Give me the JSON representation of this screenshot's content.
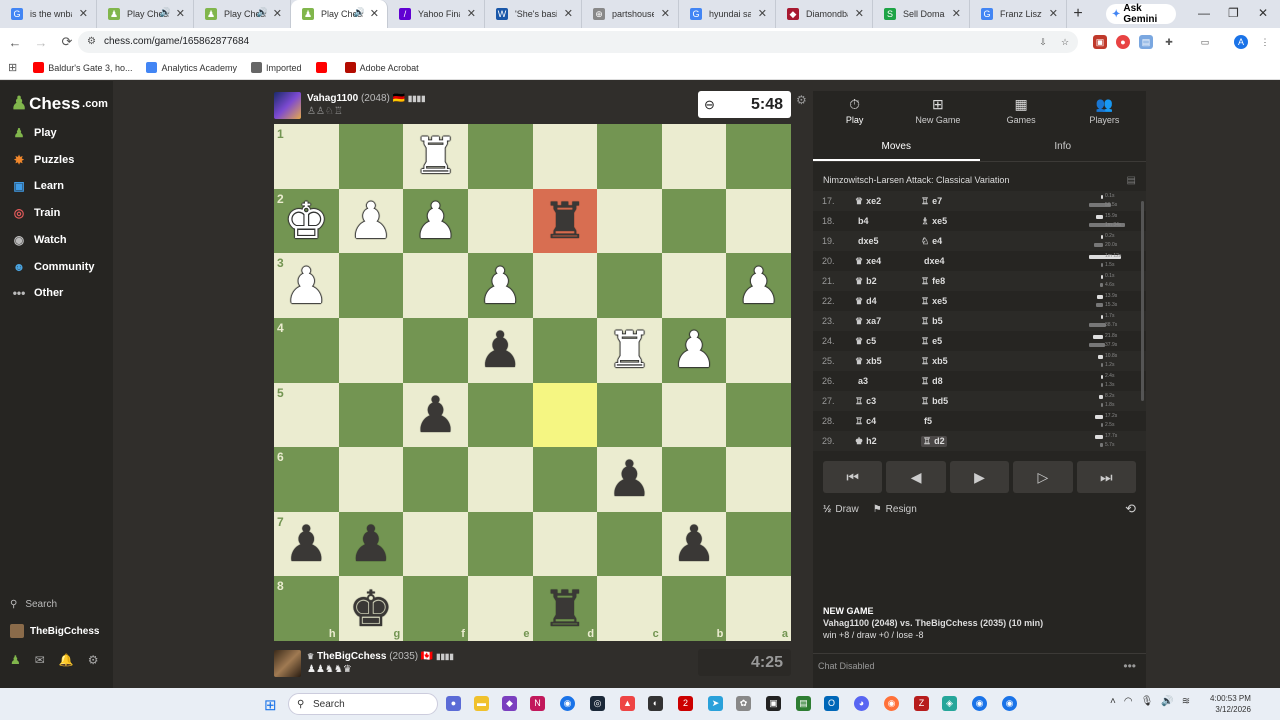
{
  "browser": {
    "tabs": [
      {
        "title": "is the wnba p",
        "color": "#4285f4",
        "glyph": "G",
        "active": false
      },
      {
        "title": "Play Chess",
        "color": "#81b64c",
        "glyph": "♟",
        "active": false,
        "sound": true
      },
      {
        "title": "Play Chess",
        "color": "#81b64c",
        "glyph": "♟",
        "active": false,
        "sound": true
      },
      {
        "title": "Play Chess",
        "color": "#81b64c",
        "glyph": "♟",
        "active": true,
        "sound": true
      },
      {
        "title": "Yahoo Finance",
        "color": "#6001d2",
        "glyph": "/",
        "active": false
      },
      {
        "title": "'She's basical",
        "color": "#1a57a8",
        "glyph": "W",
        "active": false
      },
      {
        "title": "partshouse.co",
        "color": "#888888",
        "glyph": "⊕",
        "active": false
      },
      {
        "title": "hyundai santa",
        "color": "#4285f4",
        "glyph": "G",
        "active": false
      },
      {
        "title": "Diamondbacks",
        "color": "#a71930",
        "glyph": "◆",
        "active": false
      },
      {
        "title": "Sell Domains",
        "color": "#1ea446",
        "glyph": "S",
        "active": false
      },
      {
        "title": "Franz Liszt - ",
        "color": "#4285f4",
        "glyph": "G",
        "active": false
      }
    ],
    "new_tab": "+",
    "gemini": "Ask Gemini",
    "url": "chess.com/game/165862877684",
    "bookmarks": [
      {
        "label": "Baldur's Gate 3, ho...",
        "color": "#ff0000"
      },
      {
        "label": "Analytics Academy",
        "color": "#4285f4"
      },
      {
        "label": "Imported",
        "color": "#666666"
      },
      {
        "label": "",
        "color": "#ff0000"
      },
      {
        "label": "Adobe Acrobat",
        "color": "#b30b00"
      }
    ]
  },
  "sidebar": {
    "logo": "Chess",
    "logo_suffix": ".com",
    "items": [
      {
        "label": "Play",
        "icon": "♟",
        "color": "#81b64c"
      },
      {
        "label": "Puzzles",
        "icon": "✸",
        "color": "#f1882c"
      },
      {
        "label": "Learn",
        "icon": "▣",
        "color": "#3f9be6"
      },
      {
        "label": "Train",
        "icon": "◎",
        "color": "#e05a5a"
      },
      {
        "label": "Watch",
        "icon": "◉",
        "color": "#bbbbbb"
      },
      {
        "label": "Community",
        "icon": "☻",
        "color": "#4aa3df"
      },
      {
        "label": "Other",
        "icon": "•••",
        "color": "#bbbbbb"
      }
    ],
    "search": "Search",
    "username": "TheBigCchess"
  },
  "game": {
    "top_player": {
      "name": "Vahag1100",
      "rating": "(2048)",
      "flag": "🇩🇪",
      "captured": "♙♙♘♖",
      "clock": "5:48"
    },
    "bottom_player": {
      "name": "TheBigCchess",
      "rating": "(2035)",
      "flag": "🇨🇦",
      "captured": "♟♟♞♞♛",
      "clock": "4:25"
    },
    "ranks": [
      "1",
      "2",
      "3",
      "4",
      "5",
      "6",
      "7",
      "8"
    ],
    "files": [
      "h",
      "g",
      "f",
      "e",
      "d",
      "c",
      "b",
      "a"
    ],
    "pieces": [
      {
        "sq": 2,
        "p": "♜",
        "c": "w"
      },
      {
        "sq": 8,
        "p": "♚",
        "c": "w"
      },
      {
        "sq": 9,
        "p": "♟",
        "c": "w"
      },
      {
        "sq": 10,
        "p": "♟",
        "c": "w"
      },
      {
        "sq": 12,
        "p": "♜",
        "c": "b"
      },
      {
        "sq": 16,
        "p": "♟",
        "c": "w"
      },
      {
        "sq": 19,
        "p": "♟",
        "c": "w"
      },
      {
        "sq": 23,
        "p": "♟",
        "c": "w"
      },
      {
        "sq": 27,
        "p": "♟",
        "c": "b"
      },
      {
        "sq": 29,
        "p": "♜",
        "c": "w"
      },
      {
        "sq": 30,
        "p": "♟",
        "c": "w"
      },
      {
        "sq": 34,
        "p": "♟",
        "c": "b"
      },
      {
        "sq": 45,
        "p": "♟",
        "c": "b"
      },
      {
        "sq": 48,
        "p": "♟",
        "c": "b"
      },
      {
        "sq": 49,
        "p": "♟",
        "c": "b"
      },
      {
        "sq": 54,
        "p": "♟",
        "c": "b"
      },
      {
        "sq": 57,
        "p": "♚",
        "c": "b"
      },
      {
        "sq": 60,
        "p": "♜",
        "c": "b"
      }
    ],
    "highlight_red": 12,
    "highlight_yellow": 36
  },
  "panel": {
    "tabs": [
      {
        "label": "Play",
        "icon": "⏱"
      },
      {
        "label": "New Game",
        "icon": "⊞"
      },
      {
        "label": "Games",
        "icon": "▦"
      },
      {
        "label": "Players",
        "icon": "👥"
      }
    ],
    "subtabs": [
      "Moves",
      "Info"
    ],
    "opening": "Nimzowitsch-Larsen Attack: Classical Variation",
    "moves": [
      {
        "n": "17.",
        "wg": "♛",
        "w": "xe2",
        "bg": "♖",
        "b": "e7",
        "wt": "0.1s",
        "bt": "56.5s",
        "wp": 0.05,
        "bp": 0.55
      },
      {
        "n": "18.",
        "wg": "",
        "w": "b4",
        "bg": "♗",
        "b": "xe5",
        "wt": "15.9s",
        "bt": "1m 34s",
        "wp": 0.18,
        "bp": 0.9
      },
      {
        "n": "19.",
        "wg": "",
        "w": "dxe5",
        "bg": "♘",
        "b": "e4",
        "wt": "0.2s",
        "bt": "20.0s",
        "wp": 0.05,
        "bp": 0.22
      },
      {
        "n": "20.",
        "wg": "♛",
        "w": "xe4",
        "bg": "",
        "b": "dxe4",
        "wt": "1m 12s",
        "bt": "1.5s",
        "wp": 0.8,
        "bp": 0.05
      },
      {
        "n": "21.",
        "wg": "♛",
        "w": "b2",
        "bg": "♖",
        "b": "fe8",
        "wt": "0.1s",
        "bt": "4.6s",
        "wp": 0.05,
        "bp": 0.08
      },
      {
        "n": "22.",
        "wg": "♛",
        "w": "d4",
        "bg": "♖",
        "b": "xe5",
        "wt": "13.9s",
        "bt": "15.3s",
        "wp": 0.15,
        "bp": 0.17
      },
      {
        "n": "23.",
        "wg": "♛",
        "w": "xa7",
        "bg": "♖",
        "b": "b5",
        "wt": "1.7s",
        "bt": "38.7s",
        "wp": 0.05,
        "bp": 0.42
      },
      {
        "n": "24.",
        "wg": "♛",
        "w": "c5",
        "bg": "♖",
        "b": "e5",
        "wt": "21.8s",
        "bt": "37.9s",
        "wp": 0.24,
        "bp": 0.41
      },
      {
        "n": "25.",
        "wg": "♛",
        "w": "xb5",
        "bg": "♖",
        "b": "xb5",
        "wt": "10.8s",
        "bt": "1.2s",
        "wp": 0.12,
        "bp": 0.05
      },
      {
        "n": "26.",
        "wg": "",
        "w": "a3",
        "bg": "♖",
        "b": "d8",
        "wt": "2.4s",
        "bt": "1.3s",
        "wp": 0.05,
        "bp": 0.05
      },
      {
        "n": "27.",
        "wg": "♖",
        "w": "c3",
        "bg": "♖",
        "b": "bd5",
        "wt": "8.2s",
        "bt": "1.8s",
        "wp": 0.09,
        "bp": 0.05
      },
      {
        "n": "28.",
        "wg": "♖",
        "w": "c4",
        "bg": "",
        "b": "f5",
        "wt": "17.2s",
        "bt": "2.5s",
        "wp": 0.19,
        "bp": 0.05
      },
      {
        "n": "29.",
        "wg": "♚",
        "w": "h2",
        "bg": "♖",
        "b": "d2",
        "wt": "17.7s",
        "bt": "5.7s",
        "wp": 0.19,
        "bp": 0.07
      }
    ],
    "controls": [
      "⏮",
      "◀",
      "▶",
      "▷",
      "⏭"
    ],
    "draw": "Draw",
    "draw_icon": "½",
    "resign": "Resign",
    "resign_icon": "⚑",
    "flip_icon": "⟲",
    "new_game_title": "NEW GAME",
    "new_game_match": "Vahag1100 (2048) vs. TheBigCchess (2035) (10 min)",
    "new_game_record": "win +8 / draw +0 / lose -8",
    "chat": "Chat Disabled"
  },
  "taskbar": {
    "search": "Search",
    "time": "4:00:53 PM",
    "date": "3/12/2026"
  }
}
